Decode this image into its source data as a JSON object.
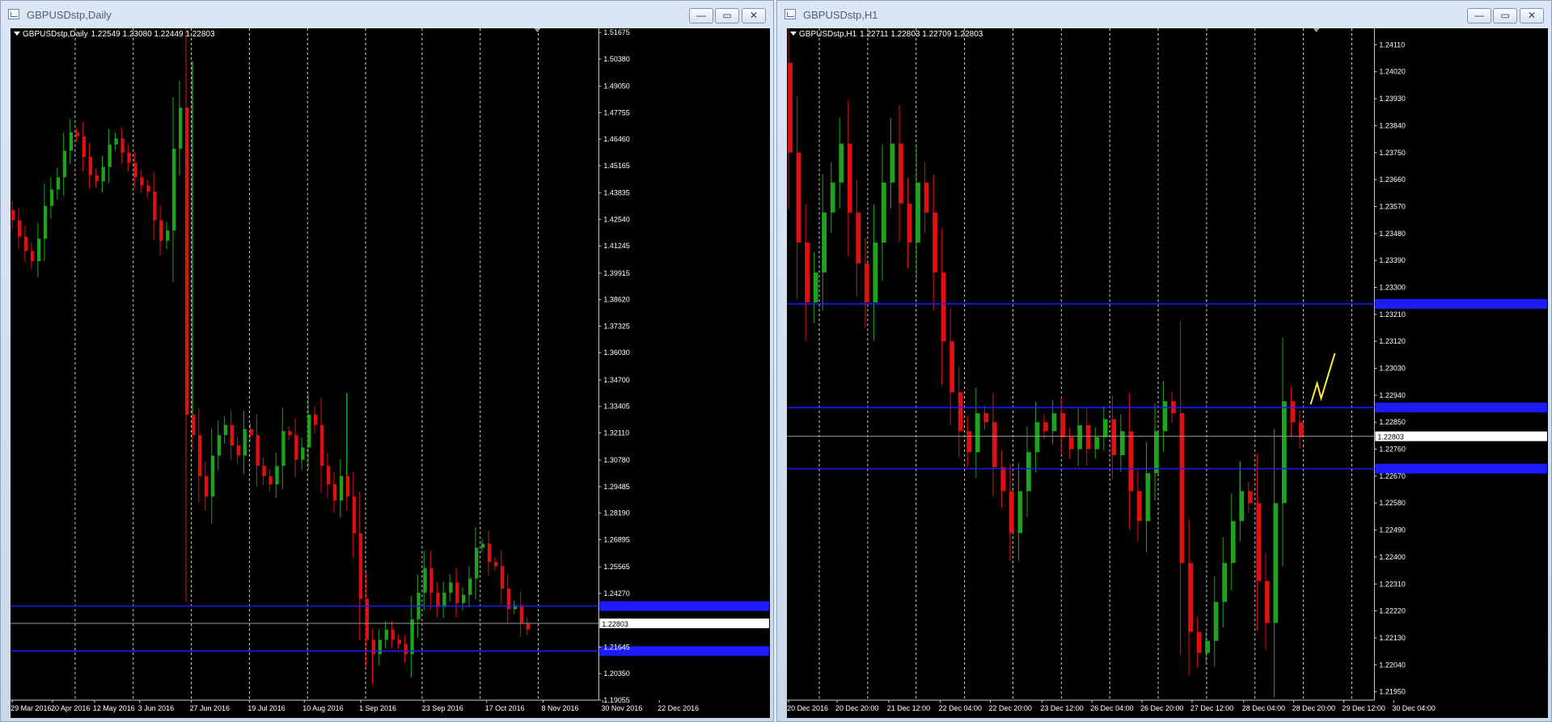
{
  "windows": [
    {
      "title": "GBPUSDstp,Daily",
      "info": {
        "symbol": "GBPUSDstp,Daily",
        "ohlc": "1.22549 1.23080 1.22449 1.22803"
      },
      "chart_data": {
        "type": "candlestick",
        "symbol": "GBPUSDstp",
        "timeframe": "Daily",
        "y_ticks": [
          "1.51675",
          "1.50380",
          "1.49050",
          "1.47755",
          "1.46460",
          "1.45165",
          "1.43835",
          "1.42540",
          "1.41245",
          "1.39915",
          "1.38620",
          "1.37325",
          "1.36030",
          "1.34700",
          "1.33405",
          "1.32110",
          "1.30780",
          "1.29485",
          "1.28190",
          "1.26895",
          "1.25565",
          "1.24270",
          "1.21645",
          "1.20350",
          "1.19055"
        ],
        "x_ticks": [
          "29 Mar 2016",
          "20 Apr 2016",
          "12 May 2016",
          "3 Jun 2016",
          "27 Jun 2016",
          "19 Jul 2016",
          "10 Aug 2016",
          "1 Sep 2016",
          "23 Sep 2016",
          "17 Oct 2016",
          "8 Nov 2016",
          "30 Nov 2016",
          "22 Dec 2016"
        ],
        "ylim": [
          1.1905,
          1.5188
        ],
        "price_label": "1.22803",
        "current_price": 1.22803,
        "hlines": [
          1.2365,
          1.2145
        ],
        "path": [
          1.43,
          1.425,
          1.417,
          1.41,
          1.405,
          1.416,
          1.432,
          1.44,
          1.446,
          1.459,
          1.468,
          1.466,
          1.456,
          1.447,
          1.444,
          1.451,
          1.462,
          1.465,
          1.458,
          1.453,
          1.446,
          1.442,
          1.439,
          1.425,
          1.415,
          1.42,
          1.46,
          1.48,
          1.33,
          1.32,
          1.3,
          1.29,
          1.31,
          1.32,
          1.325,
          1.315,
          1.31,
          1.323,
          1.32,
          1.305,
          1.3,
          1.296,
          1.305,
          1.322,
          1.32,
          1.308,
          1.314,
          1.33,
          1.325,
          1.305,
          1.296,
          1.288,
          1.3,
          1.29,
          1.272,
          1.24,
          1.22,
          1.213,
          1.22,
          1.225,
          1.22,
          1.218,
          1.213,
          1.23,
          1.243,
          1.255,
          1.243,
          1.236,
          1.243,
          1.248,
          1.238,
          1.242,
          1.25,
          1.265,
          1.267,
          1.258,
          1.256,
          1.245,
          1.235,
          1.237,
          1.228,
          1.225
        ],
        "spikes": [
          [
            52,
            1.3405
          ],
          [
            28,
            1.5025
          ],
          [
            56,
            1.1985
          ]
        ]
      }
    },
    {
      "title": "GBPUSDstp,H1",
      "info": {
        "symbol": "GBPUSDstp,H1",
        "ohlc": "1.22711 1.22803 1.22709 1.22803"
      },
      "chart_data": {
        "type": "candlestick",
        "symbol": "GBPUSDstp",
        "timeframe": "H1",
        "y_ticks": [
          "1.24110",
          "1.24020",
          "1.23930",
          "1.23840",
          "1.23750",
          "1.23660",
          "1.23570",
          "1.23480",
          "1.23390",
          "1.23300",
          "1.23210",
          "1.23120",
          "1.23030",
          "1.22940",
          "1.22850",
          "1.22760",
          "1.22670",
          "1.22580",
          "1.22490",
          "1.22400",
          "1.22310",
          "1.22220",
          "1.22130",
          "1.22040",
          "1.21950"
        ],
        "x_ticks": [
          "20 Dec 2016",
          "20 Dec 20:00",
          "21 Dec 12:00",
          "22 Dec 04:00",
          "22 Dec 20:00",
          "23 Dec 12:00",
          "26 Dec 04:00",
          "26 Dec 20:00",
          "27 Dec 12:00",
          "28 Dec 04:00",
          "28 Dec 20:00",
          "29 Dec 12:00",
          "30 Dec 04:00"
        ],
        "ylim": [
          1.21922,
          1.24165
        ],
        "price_label": "1.22803",
        "current_price": 1.22803,
        "hlines": [
          1.23245,
          1.22899,
          1.22695
        ],
        "path": [
          1.2405,
          1.2375,
          1.2345,
          1.2325,
          1.2335,
          1.2355,
          1.2365,
          1.2378,
          1.2355,
          1.2338,
          1.2325,
          1.2345,
          1.2365,
          1.2378,
          1.2358,
          1.2345,
          1.2365,
          1.2355,
          1.2335,
          1.2312,
          1.2295,
          1.2282,
          1.2275,
          1.2288,
          1.2285,
          1.227,
          1.2262,
          1.2248,
          1.2262,
          1.2275,
          1.2285,
          1.2282,
          1.2288,
          1.228,
          1.2276,
          1.2284,
          1.2276,
          1.228,
          1.2286,
          1.2274,
          1.2282,
          1.2262,
          1.2252,
          1.2268,
          1.2282,
          1.2292,
          1.2288,
          1.2238,
          1.2215,
          1.2208,
          1.2212,
          1.2225,
          1.2238,
          1.2252,
          1.2262,
          1.2258,
          1.2232,
          1.2218,
          1.2258,
          1.2292,
          1.2285,
          1.228
        ],
        "spikes": [
          [
            9,
            1.2332
          ],
          [
            53,
            1.2272
          ]
        ]
      },
      "annotation_color": "#ffeb3b"
    }
  ],
  "colors": {
    "bull": "#1fa31f",
    "bear": "#e01010",
    "grid": "#ffffff",
    "level": "#1c1cff",
    "price": "#9a9a9a",
    "axis_text": "#ffffff",
    "background": "#000000"
  },
  "window_buttons": {
    "minimize": "—",
    "maximize": "▭",
    "close": "✕"
  }
}
